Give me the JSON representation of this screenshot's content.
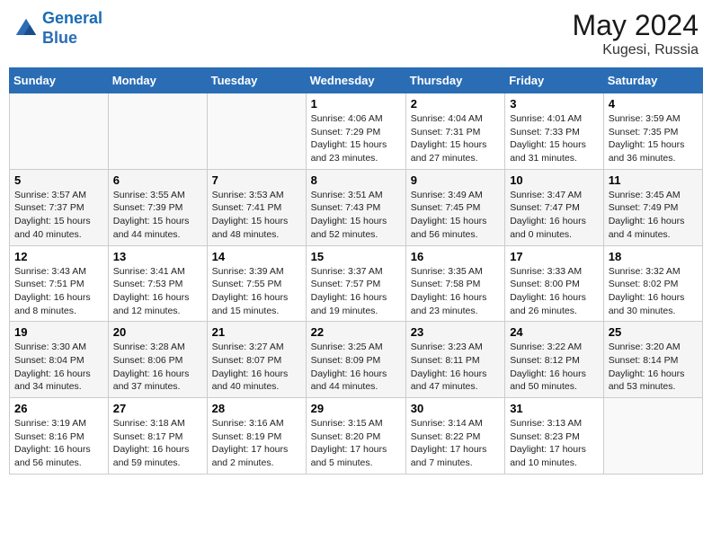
{
  "header": {
    "logo_line1": "General",
    "logo_line2": "Blue",
    "month_year": "May 2024",
    "location": "Kugesi, Russia"
  },
  "weekdays": [
    "Sunday",
    "Monday",
    "Tuesday",
    "Wednesday",
    "Thursday",
    "Friday",
    "Saturday"
  ],
  "weeks": [
    [
      {
        "day": "",
        "info": ""
      },
      {
        "day": "",
        "info": ""
      },
      {
        "day": "",
        "info": ""
      },
      {
        "day": "1",
        "info": "Sunrise: 4:06 AM\nSunset: 7:29 PM\nDaylight: 15 hours\nand 23 minutes."
      },
      {
        "day": "2",
        "info": "Sunrise: 4:04 AM\nSunset: 7:31 PM\nDaylight: 15 hours\nand 27 minutes."
      },
      {
        "day": "3",
        "info": "Sunrise: 4:01 AM\nSunset: 7:33 PM\nDaylight: 15 hours\nand 31 minutes."
      },
      {
        "day": "4",
        "info": "Sunrise: 3:59 AM\nSunset: 7:35 PM\nDaylight: 15 hours\nand 36 minutes."
      }
    ],
    [
      {
        "day": "5",
        "info": "Sunrise: 3:57 AM\nSunset: 7:37 PM\nDaylight: 15 hours\nand 40 minutes."
      },
      {
        "day": "6",
        "info": "Sunrise: 3:55 AM\nSunset: 7:39 PM\nDaylight: 15 hours\nand 44 minutes."
      },
      {
        "day": "7",
        "info": "Sunrise: 3:53 AM\nSunset: 7:41 PM\nDaylight: 15 hours\nand 48 minutes."
      },
      {
        "day": "8",
        "info": "Sunrise: 3:51 AM\nSunset: 7:43 PM\nDaylight: 15 hours\nand 52 minutes."
      },
      {
        "day": "9",
        "info": "Sunrise: 3:49 AM\nSunset: 7:45 PM\nDaylight: 15 hours\nand 56 minutes."
      },
      {
        "day": "10",
        "info": "Sunrise: 3:47 AM\nSunset: 7:47 PM\nDaylight: 16 hours\nand 0 minutes."
      },
      {
        "day": "11",
        "info": "Sunrise: 3:45 AM\nSunset: 7:49 PM\nDaylight: 16 hours\nand 4 minutes."
      }
    ],
    [
      {
        "day": "12",
        "info": "Sunrise: 3:43 AM\nSunset: 7:51 PM\nDaylight: 16 hours\nand 8 minutes."
      },
      {
        "day": "13",
        "info": "Sunrise: 3:41 AM\nSunset: 7:53 PM\nDaylight: 16 hours\nand 12 minutes."
      },
      {
        "day": "14",
        "info": "Sunrise: 3:39 AM\nSunset: 7:55 PM\nDaylight: 16 hours\nand 15 minutes."
      },
      {
        "day": "15",
        "info": "Sunrise: 3:37 AM\nSunset: 7:57 PM\nDaylight: 16 hours\nand 19 minutes."
      },
      {
        "day": "16",
        "info": "Sunrise: 3:35 AM\nSunset: 7:58 PM\nDaylight: 16 hours\nand 23 minutes."
      },
      {
        "day": "17",
        "info": "Sunrise: 3:33 AM\nSunset: 8:00 PM\nDaylight: 16 hours\nand 26 minutes."
      },
      {
        "day": "18",
        "info": "Sunrise: 3:32 AM\nSunset: 8:02 PM\nDaylight: 16 hours\nand 30 minutes."
      }
    ],
    [
      {
        "day": "19",
        "info": "Sunrise: 3:30 AM\nSunset: 8:04 PM\nDaylight: 16 hours\nand 34 minutes."
      },
      {
        "day": "20",
        "info": "Sunrise: 3:28 AM\nSunset: 8:06 PM\nDaylight: 16 hours\nand 37 minutes."
      },
      {
        "day": "21",
        "info": "Sunrise: 3:27 AM\nSunset: 8:07 PM\nDaylight: 16 hours\nand 40 minutes."
      },
      {
        "day": "22",
        "info": "Sunrise: 3:25 AM\nSunset: 8:09 PM\nDaylight: 16 hours\nand 44 minutes."
      },
      {
        "day": "23",
        "info": "Sunrise: 3:23 AM\nSunset: 8:11 PM\nDaylight: 16 hours\nand 47 minutes."
      },
      {
        "day": "24",
        "info": "Sunrise: 3:22 AM\nSunset: 8:12 PM\nDaylight: 16 hours\nand 50 minutes."
      },
      {
        "day": "25",
        "info": "Sunrise: 3:20 AM\nSunset: 8:14 PM\nDaylight: 16 hours\nand 53 minutes."
      }
    ],
    [
      {
        "day": "26",
        "info": "Sunrise: 3:19 AM\nSunset: 8:16 PM\nDaylight: 16 hours\nand 56 minutes."
      },
      {
        "day": "27",
        "info": "Sunrise: 3:18 AM\nSunset: 8:17 PM\nDaylight: 16 hours\nand 59 minutes."
      },
      {
        "day": "28",
        "info": "Sunrise: 3:16 AM\nSunset: 8:19 PM\nDaylight: 17 hours\nand 2 minutes."
      },
      {
        "day": "29",
        "info": "Sunrise: 3:15 AM\nSunset: 8:20 PM\nDaylight: 17 hours\nand 5 minutes."
      },
      {
        "day": "30",
        "info": "Sunrise: 3:14 AM\nSunset: 8:22 PM\nDaylight: 17 hours\nand 7 minutes."
      },
      {
        "day": "31",
        "info": "Sunrise: 3:13 AM\nSunset: 8:23 PM\nDaylight: 17 hours\nand 10 minutes."
      },
      {
        "day": "",
        "info": ""
      }
    ]
  ]
}
